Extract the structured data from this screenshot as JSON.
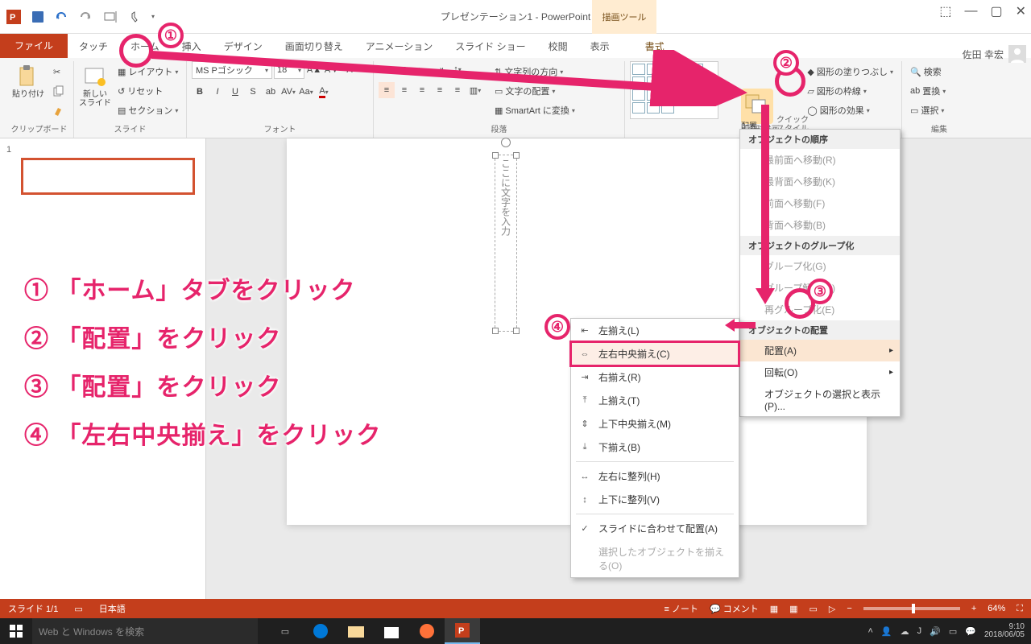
{
  "title": "プレゼンテーション1 - PowerPoint",
  "context_tab": "描画ツール",
  "user_name": "佐田 幸宏",
  "tabs": {
    "file": "ファイル",
    "touch": "タッチ",
    "home": "ホーム",
    "insert": "挿入",
    "design": "デザイン",
    "transition": "画面切り替え",
    "anim": "アニメーション",
    "slideshow": "スライド ショー",
    "review": "校閲",
    "view": "表示",
    "format": "書式"
  },
  "ribbon": {
    "clipboard": {
      "paste": "貼り付け",
      "label": "クリップボード"
    },
    "slides": {
      "new": "新しい\nスライド",
      "layout": "レイアウト",
      "reset": "リセット",
      "section": "セクション",
      "label": "スライド"
    },
    "font": {
      "name": "MS Pゴシック",
      "size": "18",
      "label": "フォント"
    },
    "para": {
      "text_dir": "文字列の方向",
      "text_align": "文字の配置",
      "smartart": "SmartArt に変換",
      "label": "段落"
    },
    "drawing": {
      "arrange": "配置",
      "quick": "クイック\nスタイル",
      "fill": "図形の塗りつぶし",
      "outline": "図形の枠線",
      "effects": "図形の効果",
      "label": "図形描画"
    },
    "editing": {
      "find": "検索",
      "replace": "置換",
      "select": "選択",
      "label": "編集"
    }
  },
  "placeholder_text": "ここに文字を入力",
  "menu1": {
    "hdr1": "オブジェクトの順序",
    "front": "最前面へ移動(R)",
    "back": "最背面へ移動(K)",
    "forward": "前面へ移動(F)",
    "backward": "背面へ移動(B)",
    "hdr2": "オブジェクトのグループ化",
    "group": "グループ化(G)",
    "ungroup": "グループ解除(U)",
    "regroup": "再グループ化(E)",
    "hdr3": "オブジェクトの配置",
    "align": "配置(A)",
    "rotate": "回転(O)",
    "sel": "オブジェクトの選択と表示(P)..."
  },
  "menu2": {
    "left": "左揃え(L)",
    "centerH": "左右中央揃え(C)",
    "right": "右揃え(R)",
    "top": "上揃え(T)",
    "centerV": "上下中央揃え(M)",
    "bottom": "下揃え(B)",
    "distH": "左右に整列(H)",
    "distV": "上下に整列(V)",
    "toslide": "スライドに合わせて配置(A)",
    "tosel": "選択したオブジェクトを揃える(O)"
  },
  "steps": {
    "s1": "①",
    "s2": "②",
    "s3": "③",
    "s4": "④",
    "t1": "「ホーム」タブをクリック",
    "t2": "「配置」をクリック",
    "t3": "「配置」をクリック",
    "t4": "「左右中央揃え」をクリック"
  },
  "status": {
    "slide": "スライド 1/1",
    "lang": "日本語",
    "notes": "ノート",
    "comments": "コメント",
    "zoom": "64%"
  },
  "taskbar": {
    "search": "Web と Windows を検索",
    "time": "9:10",
    "date": "2018/06/05"
  }
}
